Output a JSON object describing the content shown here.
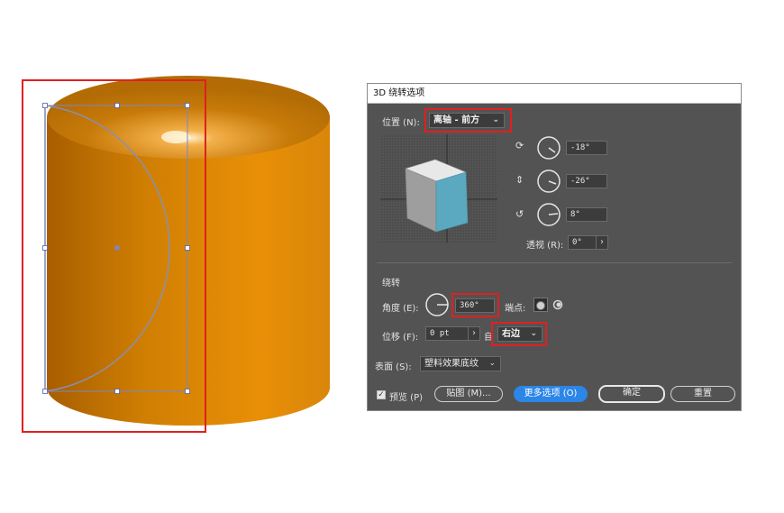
{
  "dialog": {
    "title": "3D 绕转选项",
    "position": {
      "label": "位置 (N):",
      "value": "离轴 - 前方",
      "rot_x": "-18°",
      "rot_y": "-26°",
      "rot_z": "8°",
      "perspective_label": "透视 (R):",
      "perspective_value": "0°"
    },
    "revolve": {
      "section_label": "绕转",
      "angle_label": "角度 (E):",
      "angle_value": "360°",
      "cap_label": "端点:",
      "offset_label": "位移 (F):",
      "offset_value": "0 pt",
      "from_label": "自",
      "from_value": "右边"
    },
    "surface": {
      "label": "表面 (S):",
      "value": "塑料效果底纹"
    },
    "footer": {
      "preview_label": "预览 (P)",
      "preview_checked": true,
      "map_button": "贴图 (M)...",
      "more_options_button": "更多选项 (O)",
      "ok_button": "确定",
      "reset_button": "重置"
    }
  },
  "colors": {
    "highlight": "#e02020",
    "cylinder": "#e08a05",
    "dialog_bg": "#535353",
    "cube_face": "#5aa9c0",
    "primary_button": "#2b86e8"
  }
}
